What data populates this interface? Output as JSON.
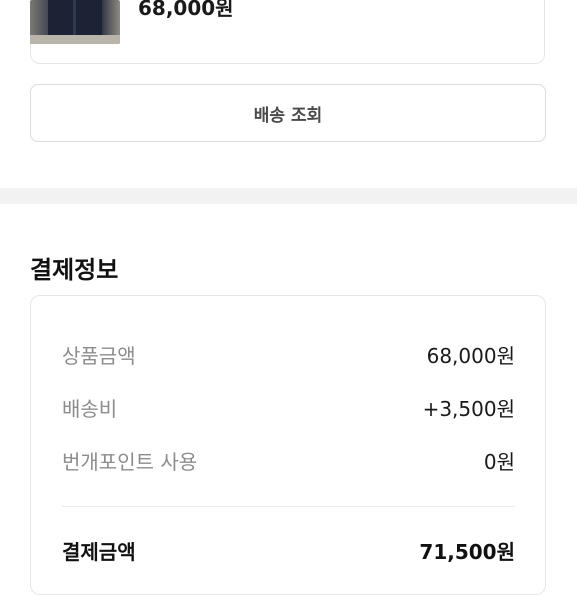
{
  "product": {
    "price": "68,000원"
  },
  "delivery": {
    "button_label": "배송 조회"
  },
  "payment": {
    "title": "결제정보",
    "rows": [
      {
        "label": "상품금액",
        "value": "68,000원"
      },
      {
        "label": "배송비",
        "value": "+3,500원"
      },
      {
        "label": "번개포인트 사용",
        "value": "0원"
      }
    ],
    "total": {
      "label": "결제금액",
      "value": "71,500원"
    }
  }
}
